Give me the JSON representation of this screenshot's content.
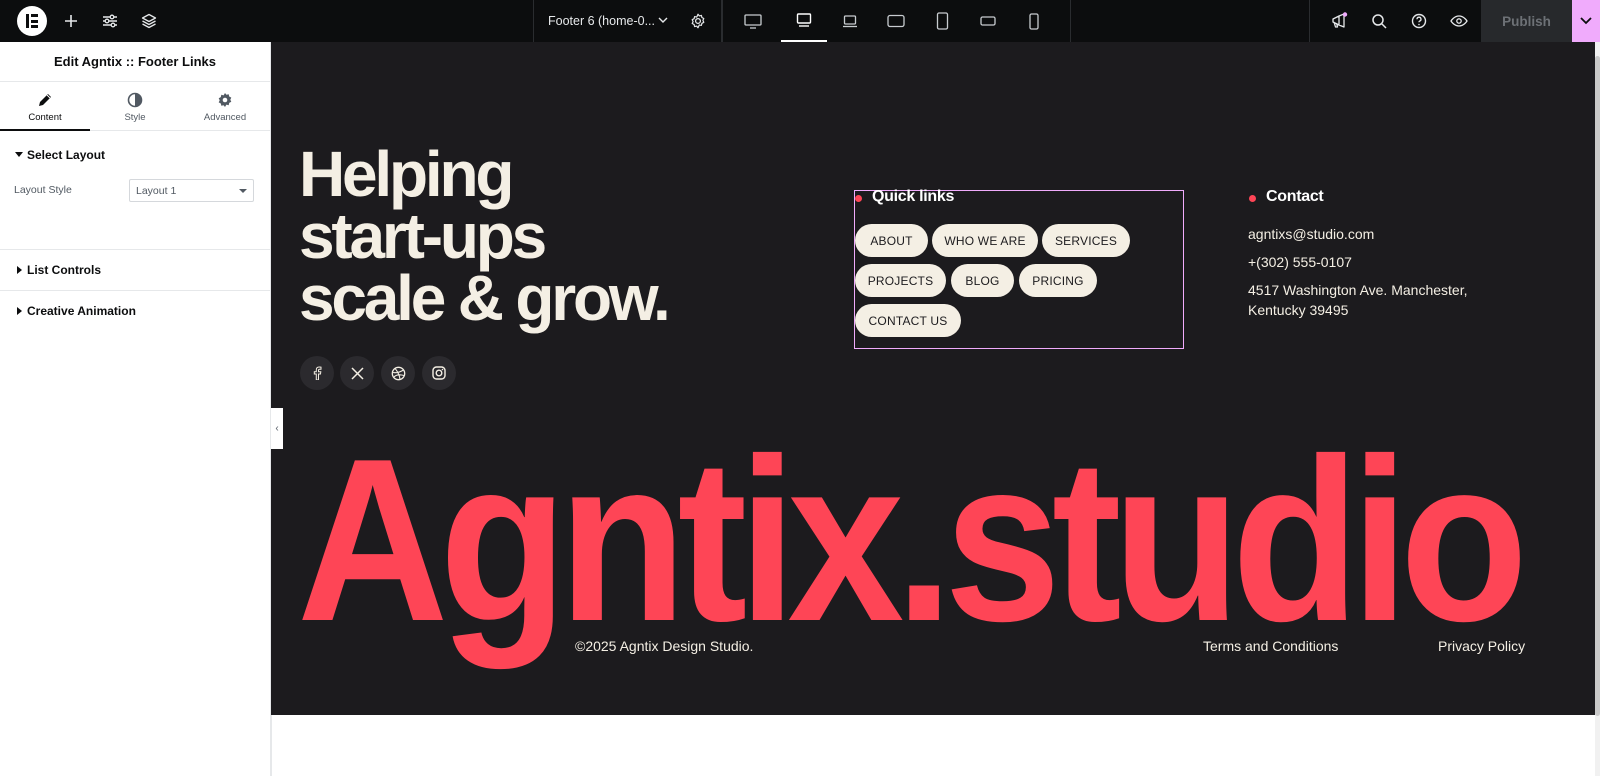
{
  "topbar": {
    "document_name": "Footer 6 (home-0...",
    "publish_label": "Publish",
    "tools": [
      "whats-new-icon",
      "search-icon",
      "help-icon",
      "preview-icon"
    ]
  },
  "panel": {
    "title": "Edit Agntix :: Footer Links",
    "tabs": [
      {
        "label": "Content",
        "icon": "pencil-icon"
      },
      {
        "label": "Style",
        "icon": "contrast-icon"
      },
      {
        "label": "Advanced",
        "icon": "gear-icon"
      }
    ],
    "sections": {
      "select_layout": "Select Layout",
      "layout_style_label": "Layout Style",
      "layout_style_value": "Layout 1",
      "list_controls": "List Controls",
      "creative_animation": "Creative Animation"
    }
  },
  "footer": {
    "headline": [
      "Helping",
      "start-ups",
      "scale & grow."
    ],
    "quick_links_title": "Quick links",
    "quick_links": [
      "ABOUT",
      "WHO WE ARE",
      "SERVICES",
      "PROJECTS",
      "BLOG",
      "PRICING",
      "CONTACT US"
    ],
    "contact_title": "Contact",
    "email": "agntixs@studio.com",
    "phone": "+(302) 555-0107",
    "address_line1": "4517 Washington Ave. Manchester,",
    "address_line2": "Kentucky 39495",
    "brand": "Agntix.studio",
    "copyright": "©2025 Agntix Design Studio.",
    "terms": "Terms and Conditions",
    "privacy": "Privacy Policy"
  },
  "colors": {
    "canvas_bg": "#1c1b1e",
    "cream": "#f4efe4",
    "accent_red": "#fe4556",
    "selection": "#f0abfc"
  }
}
